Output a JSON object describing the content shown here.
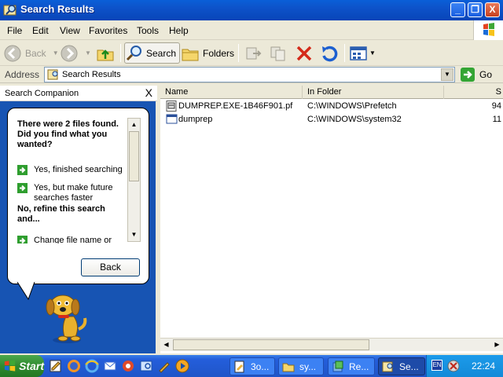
{
  "window": {
    "title": "Search Results",
    "minimize_label": "_",
    "maximize_label": "❐",
    "close_label": "X"
  },
  "menu": [
    "File",
    "Edit",
    "View",
    "Favorites",
    "Tools",
    "Help"
  ],
  "toolbar": {
    "back_label": "Back",
    "search_label": "Search",
    "folders_label": "Folders"
  },
  "address": {
    "label": "Address",
    "value": "Search Results",
    "go_label": "Go"
  },
  "companion": {
    "title": "Search Companion",
    "close_label": "X",
    "heading": "There were 2 files found. Did you find what you wanted?",
    "options": [
      "Yes, finished searching",
      "Yes, but make future searches faster"
    ],
    "refine_heading": "No, refine this search and...",
    "refine_options": [
      "Change file name or keywords"
    ],
    "back_label": "Back"
  },
  "results": {
    "columns": [
      "Name",
      "In Folder",
      "S"
    ],
    "rows": [
      {
        "name": "DUMPREP.EXE-1B46F901.pf",
        "folder": "C:\\WINDOWS\\Prefetch",
        "size": "94",
        "icon": "prefetch-file-icon"
      },
      {
        "name": "dumprep",
        "folder": "C:\\WINDOWS\\system32",
        "size": "11",
        "icon": "application-icon"
      }
    ]
  },
  "taskbar": {
    "start_label": "Start",
    "tasks": [
      {
        "label": "3o..."
      },
      {
        "label": "sy..."
      },
      {
        "label": "Re..."
      },
      {
        "label": "Se..."
      }
    ],
    "lang": "EN",
    "clock": "22:24"
  },
  "colors": {
    "title_blue": "#0d52c9",
    "pane_blue": "#1754b3",
    "start_green": "#2e8a2e",
    "tray_blue": "#138ad8"
  }
}
